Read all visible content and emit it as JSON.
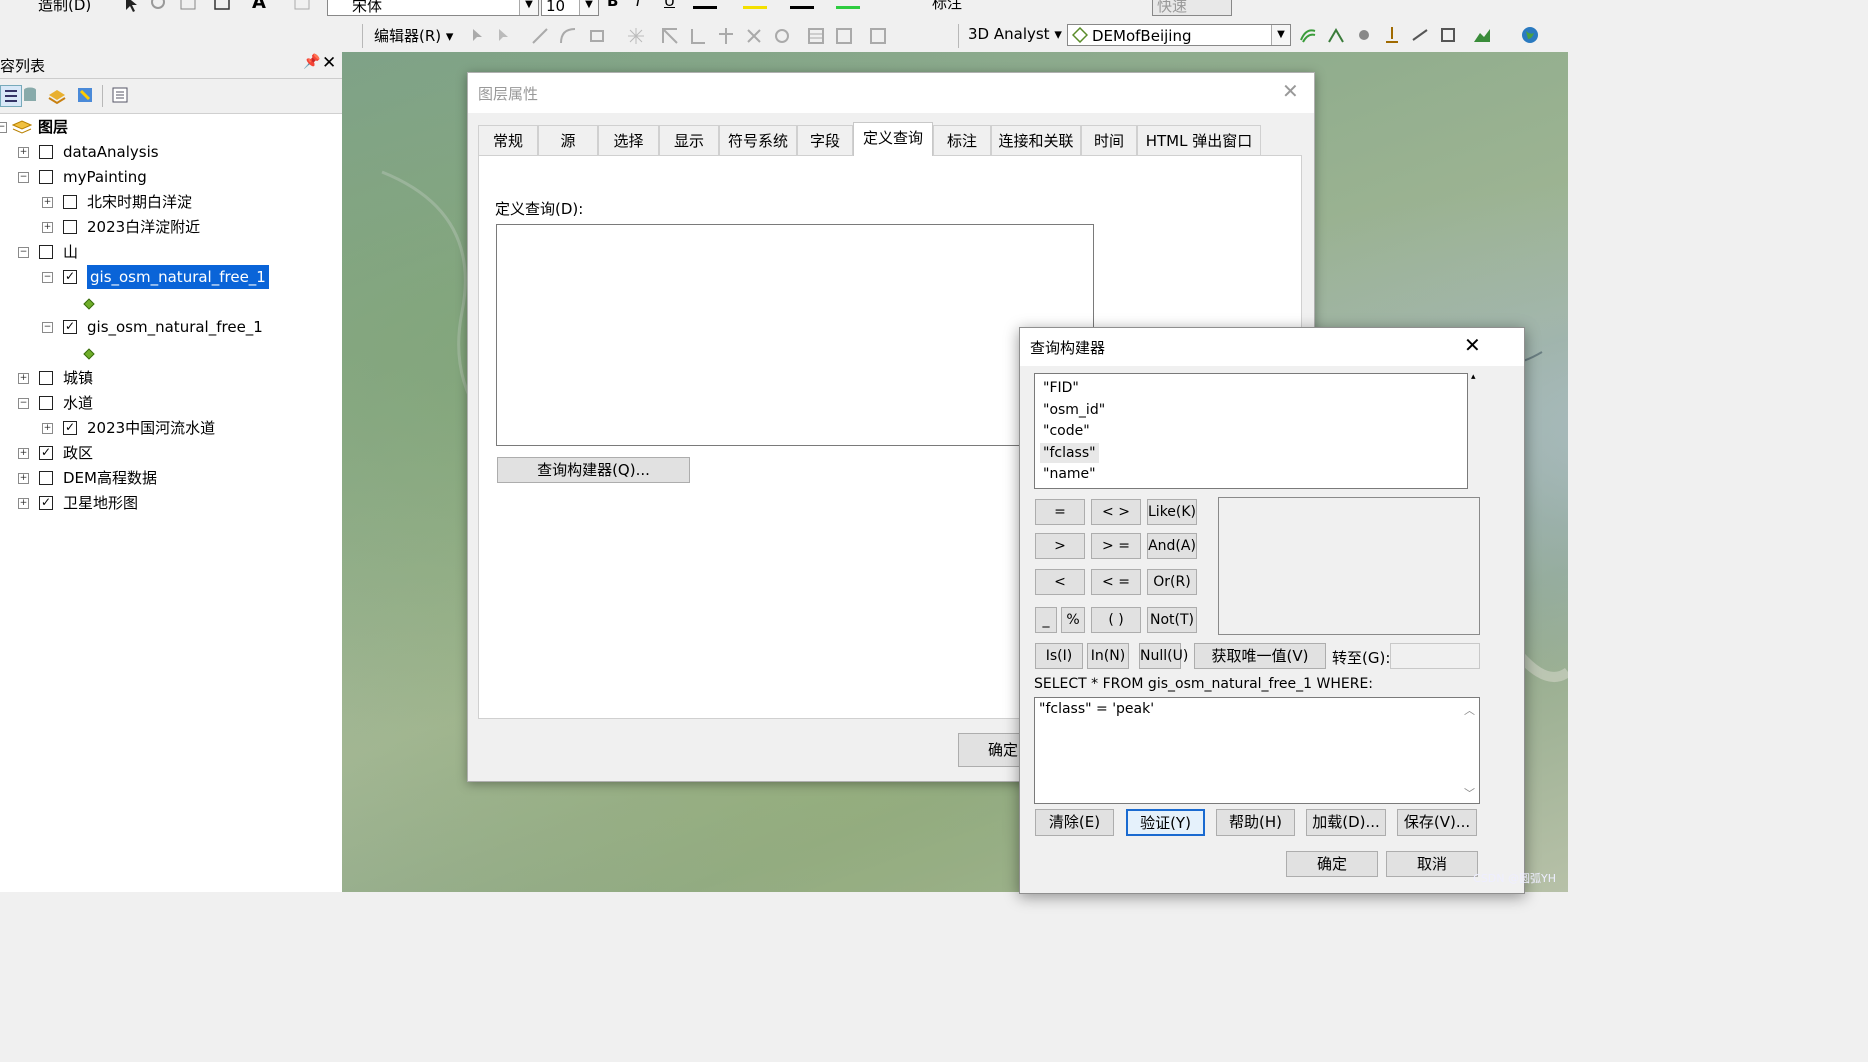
{
  "toolbar": {
    "row1_menu_label": "造制(D)",
    "font_name": "宋体",
    "font_size": "10",
    "bold": "B",
    "italic": "I",
    "underline": "U",
    "label_menu": "标注",
    "fast_combo": "快速",
    "editor_label": "编辑器(R)",
    "analyst_label": "3D Analyst",
    "analyst_layer": "DEMofBeijing"
  },
  "toc": {
    "title": "容列表",
    "root_label": "图层",
    "items": [
      {
        "label": "dataAnalysis",
        "checked": false,
        "expand": "+"
      },
      {
        "label": "myPainting",
        "checked": false,
        "expand": "-"
      },
      {
        "label": "北宋时期白洋淀",
        "checked": false,
        "expand": "+"
      },
      {
        "label": "2023白洋淀附近",
        "checked": false,
        "expand": "+"
      },
      {
        "label": "山",
        "checked": false,
        "expand": "-"
      },
      {
        "label": "gis_osm_natural_free_1",
        "checked": true,
        "expand": "-"
      },
      {
        "label": "gis_osm_natural_free_1",
        "checked": true,
        "expand": "-"
      },
      {
        "label": "城镇",
        "checked": false,
        "expand": "+"
      },
      {
        "label": "水道",
        "checked": false,
        "expand": "-"
      },
      {
        "label": "2023中国河流水道",
        "checked": true,
        "expand": "+"
      },
      {
        "label": "政区",
        "checked": true,
        "expand": "+"
      },
      {
        "label": "DEM高程数据",
        "checked": false,
        "expand": "+"
      },
      {
        "label": "卫星地形图",
        "checked": true,
        "expand": "+"
      }
    ]
  },
  "layer_props": {
    "title": "图层属性",
    "tabs": [
      "常规",
      "源",
      "选择",
      "显示",
      "符号系统",
      "字段",
      "定义查询",
      "标注",
      "连接和关联",
      "时间",
      "HTML 弹出窗口"
    ],
    "active_tab": "定义查询",
    "query_label": "定义查询(D):",
    "query_builder_button": "查询构建器(Q)...",
    "ok_button": "确定"
  },
  "query_builder": {
    "title": "查询构建器",
    "fields": [
      "\"FID\"",
      "\"osm_id\"",
      "\"code\"",
      "\"fclass\"",
      "\"name\""
    ],
    "selected_field": "\"fclass\"",
    "operators": {
      "eq": "=",
      "ne": "< >",
      "like": "Like(K)",
      "gt": ">",
      "ge": "> =",
      "and": "And(A)",
      "lt": "<",
      "le": "< =",
      "or": "Or(R)",
      "underscore": "_",
      "percent": "%",
      "parens": "( )",
      "not": "Not(T)",
      "is": "Is(I)",
      "in": "In(N)",
      "null": "Null(U)"
    },
    "unique_values_button": "获取唯一值(V)",
    "goto_label": "转至(G):",
    "sql_prefix": "SELECT * FROM gis_osm_natural_free_1 WHERE:",
    "expression": "\"fclass\" = 'peak'",
    "clear_button": "清除(E)",
    "verify_button": "验证(Y)",
    "help_button": "帮助(H)",
    "load_button": "加载(D)...",
    "save_button": "保存(V)...",
    "ok_button": "确定",
    "cancel_button": "取消"
  },
  "watermark": "CSDN @圆弧YH"
}
